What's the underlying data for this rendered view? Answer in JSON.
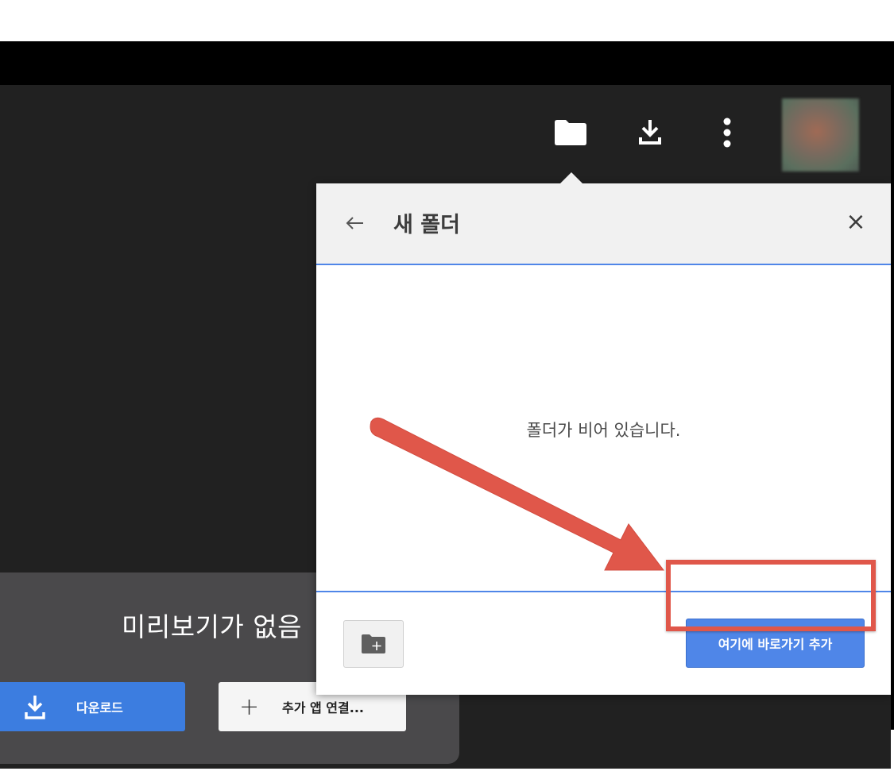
{
  "preview": {
    "no_preview_text": "미리보기가 없음",
    "download_label": "다운로드",
    "connect_apps_label": "추가 앱 연결..."
  },
  "topbar": {
    "icons": [
      "folder-icon",
      "download-icon",
      "more-vert-icon"
    ]
  },
  "dialog": {
    "title": "새 폴더",
    "close_symbol": "×",
    "empty_message": "폴더가 비어 있습니다.",
    "add_shortcut_label": "여기에 바로가기 추가"
  },
  "colors": {
    "accent_blue": "#4f86e8",
    "download_blue": "#3c7de0",
    "annotation_red": "#e0574a",
    "viewer_bg": "#212121"
  }
}
